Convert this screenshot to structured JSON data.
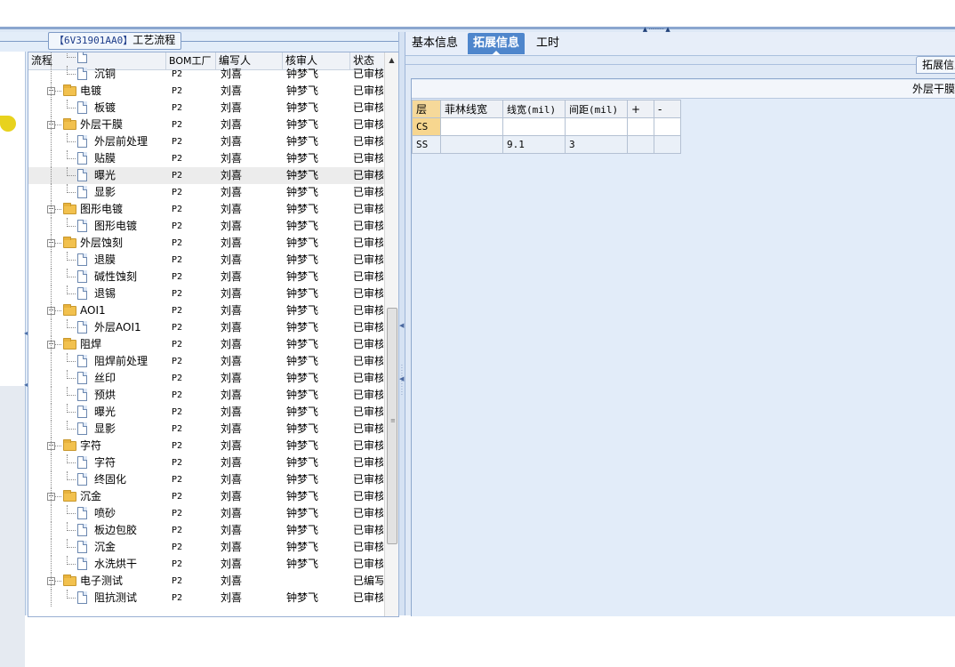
{
  "left_panel": {
    "caption_bracket": "【6V31901AA0】",
    "caption_text": "工艺流程",
    "columns": {
      "process": "流程",
      "bom_factory": "BOM工厂",
      "writer": "编写人",
      "reviewer": "核审人",
      "status": "状态"
    },
    "rows": [
      {
        "label": "",
        "bom": "",
        "writer": "",
        "reviewer": "",
        "status": ""
      },
      {
        "label": "沉铜",
        "bom": "P2",
        "writer": "刘喜",
        "reviewer": "钟梦飞",
        "status": "已审核"
      },
      {
        "label": "电镀",
        "bom": "P2",
        "writer": "刘喜",
        "reviewer": "钟梦飞",
        "status": "已审核"
      },
      {
        "label": "板镀",
        "bom": "P2",
        "writer": "刘喜",
        "reviewer": "钟梦飞",
        "status": "已审核"
      },
      {
        "label": "外层干膜",
        "bom": "P2",
        "writer": "刘喜",
        "reviewer": "钟梦飞",
        "status": "已审核"
      },
      {
        "label": "外层前处理",
        "bom": "P2",
        "writer": "刘喜",
        "reviewer": "钟梦飞",
        "status": "已审核"
      },
      {
        "label": "贴膜",
        "bom": "P2",
        "writer": "刘喜",
        "reviewer": "钟梦飞",
        "status": "已审核"
      },
      {
        "label": "曝光",
        "bom": "P2",
        "writer": "刘喜",
        "reviewer": "钟梦飞",
        "status": "已审核"
      },
      {
        "label": "显影",
        "bom": "P2",
        "writer": "刘喜",
        "reviewer": "钟梦飞",
        "status": "已审核"
      },
      {
        "label": "图形电镀",
        "bom": "P2",
        "writer": "刘喜",
        "reviewer": "钟梦飞",
        "status": "已审核"
      },
      {
        "label": "图形电镀",
        "bom": "P2",
        "writer": "刘喜",
        "reviewer": "钟梦飞",
        "status": "已审核"
      },
      {
        "label": "外层蚀刻",
        "bom": "P2",
        "writer": "刘喜",
        "reviewer": "钟梦飞",
        "status": "已审核"
      },
      {
        "label": "退膜",
        "bom": "P2",
        "writer": "刘喜",
        "reviewer": "钟梦飞",
        "status": "已审核"
      },
      {
        "label": "碱性蚀刻",
        "bom": "P2",
        "writer": "刘喜",
        "reviewer": "钟梦飞",
        "status": "已审核"
      },
      {
        "label": "退锡",
        "bom": "P2",
        "writer": "刘喜",
        "reviewer": "钟梦飞",
        "status": "已审核"
      },
      {
        "label": "AOI1",
        "bom": "P2",
        "writer": "刘喜",
        "reviewer": "钟梦飞",
        "status": "已审核"
      },
      {
        "label": "外层AOI1",
        "bom": "P2",
        "writer": "刘喜",
        "reviewer": "钟梦飞",
        "status": "已审核"
      },
      {
        "label": "阻焊",
        "bom": "P2",
        "writer": "刘喜",
        "reviewer": "钟梦飞",
        "status": "已审核"
      },
      {
        "label": "阻焊前处理",
        "bom": "P2",
        "writer": "刘喜",
        "reviewer": "钟梦飞",
        "status": "已审核"
      },
      {
        "label": "丝印",
        "bom": "P2",
        "writer": "刘喜",
        "reviewer": "钟梦飞",
        "status": "已审核"
      },
      {
        "label": "预烘",
        "bom": "P2",
        "writer": "刘喜",
        "reviewer": "钟梦飞",
        "status": "已审核"
      },
      {
        "label": "曝光",
        "bom": "P2",
        "writer": "刘喜",
        "reviewer": "钟梦飞",
        "status": "已审核"
      },
      {
        "label": "显影",
        "bom": "P2",
        "writer": "刘喜",
        "reviewer": "钟梦飞",
        "status": "已审核"
      },
      {
        "label": "字符",
        "bom": "P2",
        "writer": "刘喜",
        "reviewer": "钟梦飞",
        "status": "已审核"
      },
      {
        "label": "字符",
        "bom": "P2",
        "writer": "刘喜",
        "reviewer": "钟梦飞",
        "status": "已审核"
      },
      {
        "label": "终固化",
        "bom": "P2",
        "writer": "刘喜",
        "reviewer": "钟梦飞",
        "status": "已审核"
      },
      {
        "label": "沉金",
        "bom": "P2",
        "writer": "刘喜",
        "reviewer": "钟梦飞",
        "status": "已审核"
      },
      {
        "label": "喷砂",
        "bom": "P2",
        "writer": "刘喜",
        "reviewer": "钟梦飞",
        "status": "已审核"
      },
      {
        "label": "板边包胶",
        "bom": "P2",
        "writer": "刘喜",
        "reviewer": "钟梦飞",
        "status": "已审核"
      },
      {
        "label": "沉金",
        "bom": "P2",
        "writer": "刘喜",
        "reviewer": "钟梦飞",
        "status": "已审核"
      },
      {
        "label": "水洗烘干",
        "bom": "P2",
        "writer": "刘喜",
        "reviewer": "钟梦飞",
        "status": "已审核"
      },
      {
        "label": "电子测试",
        "bom": "P2",
        "writer": "刘喜",
        "reviewer": "",
        "status": "已编写"
      },
      {
        "label": "阻抗测试",
        "bom": "P2",
        "writer": "刘喜",
        "reviewer": "钟梦飞",
        "status": "已审核"
      }
    ]
  },
  "right_panel": {
    "tabs": [
      "基本信息",
      "拓展信息",
      "工时"
    ],
    "active_tab": "拓展信息",
    "subtab": "拓展信息",
    "section_title": "外层干膜",
    "grid": {
      "headers": [
        "层",
        "菲林线宽",
        "线宽(mil)",
        "间距(mil)",
        "+",
        "-"
      ],
      "rows": [
        {
          "layer": "CS",
          "film_width": "",
          "line_width": "",
          "spacing": "",
          "plus": "",
          "minus": ""
        },
        {
          "layer": "SS",
          "film_width": "",
          "line_width": "9.1",
          "spacing": "3",
          "plus": "",
          "minus": ""
        }
      ]
    }
  },
  "colors": {
    "active_tab": "#4e86cc",
    "panel_bg": "#e3edf9",
    "folder": "#f2c14e",
    "highlight_cell": "#f7d68f"
  }
}
